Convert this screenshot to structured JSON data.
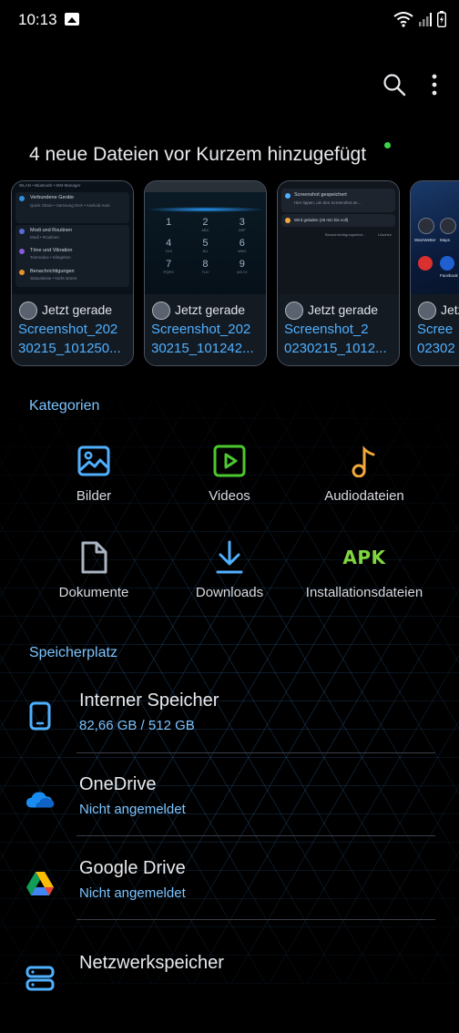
{
  "status_bar": {
    "time": "10:13"
  },
  "recent": {
    "title": "4 neue Dateien vor Kurzem hinzugefügt",
    "items": [
      {
        "time": "Jetzt gerade",
        "name": "Screenshot_202\n30215_101250..."
      },
      {
        "time": "Jetzt gerade",
        "name": "Screenshot_202\n30215_101242..."
      },
      {
        "time": "Jetzt gerade",
        "name": "Screenshot_2\n0230215_1012..."
      },
      {
        "time": "Jetzt",
        "name": "Scree\n02302"
      }
    ],
    "thumb1_lines": [
      "WLAN • Bluetooth • SIM-Manager",
      "Verbundene Geräte",
      "Quick Share • Samsung DeX • Android Auto",
      "Modi und Routinen",
      "Modi • Routinen",
      "Töne und Vibration",
      "Tonmodus • Klingelton",
      "Benachrichtigungen",
      "Statusleiste • Nicht stören"
    ],
    "thumb2_keys": [
      [
        "1",
        ""
      ],
      [
        "2",
        "ABC"
      ],
      [
        "3",
        "DEF"
      ],
      [
        "4",
        "GHI"
      ],
      [
        "5",
        "JKL"
      ],
      [
        "6",
        "MNO"
      ],
      [
        "7",
        "PQRS"
      ],
      [
        "8",
        "TUV"
      ],
      [
        "9",
        "WXYZ"
      ]
    ],
    "thumb3_lines": [
      "Screenshot gespeichert",
      "Hier tippen, um den Screenshot an...",
      "Wird geladen (25 min bis voll)",
      "Benachrichtigungseinst...",
      "Löschen"
    ],
    "thumb4_labels": [
      "WamWetter",
      "Maps",
      "Facebook"
    ]
  },
  "categories": {
    "label": "Kategorien",
    "items": [
      {
        "label": "Bilder",
        "icon": "image-icon",
        "color": "#4fb0ff"
      },
      {
        "label": "Videos",
        "icon": "video-icon",
        "color": "#4cc82f"
      },
      {
        "label": "Audiodateien",
        "icon": "music-note-icon",
        "color": "#f2a83a"
      },
      {
        "label": "Dokumente",
        "icon": "document-icon",
        "color": "#aab4c2"
      },
      {
        "label": "Downloads",
        "icon": "download-icon",
        "color": "#4fb0ff"
      },
      {
        "label": "Installationsdateien",
        "icon": "apk-icon",
        "icon_text": "APK",
        "color": "#7ed640"
      }
    ]
  },
  "storage": {
    "label": "Speicherplatz",
    "items": [
      {
        "title": "Interner Speicher",
        "sub": "82,66 GB / 512 GB",
        "icon": "phone-icon"
      },
      {
        "title": "OneDrive",
        "sub": "Nicht angemeldet",
        "icon": "onedrive-icon"
      },
      {
        "title": "Google Drive",
        "sub": "Nicht angemeldet",
        "icon": "google-drive-icon"
      },
      {
        "title": "Netzwerkspeicher",
        "sub": "",
        "icon": "network-storage-icon"
      }
    ]
  }
}
